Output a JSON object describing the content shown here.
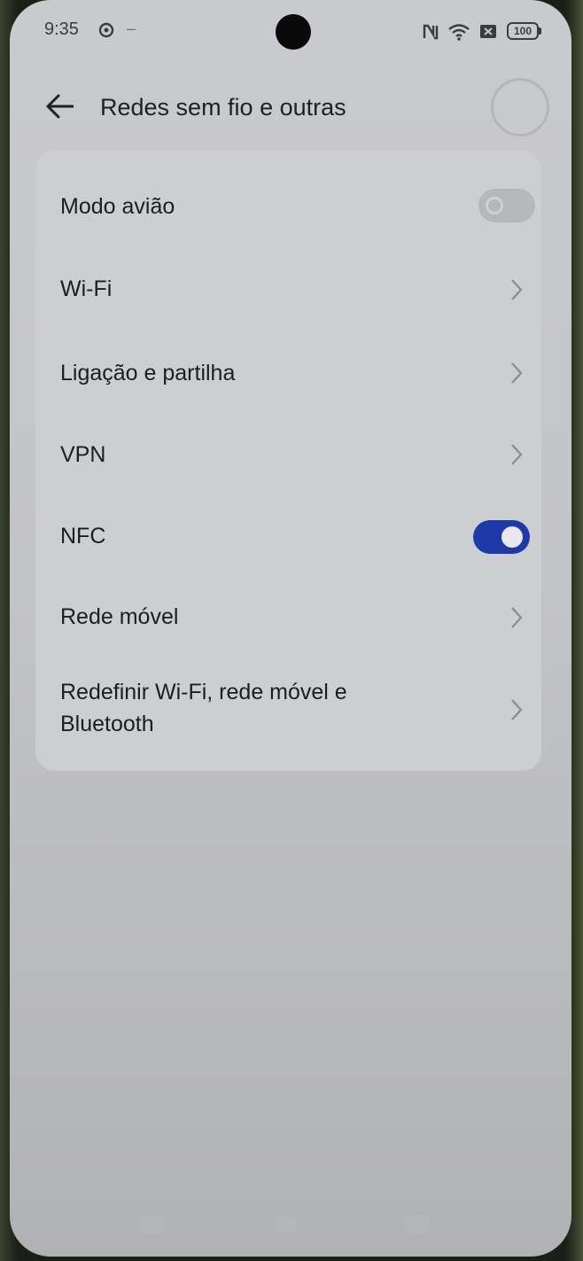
{
  "status_bar": {
    "time": "9:35",
    "battery_level": "100",
    "icons": [
      "gear-icon",
      "nfc-icon",
      "wifi-icon",
      "sim-icon",
      "battery-icon"
    ]
  },
  "header": {
    "title": "Redes sem fio e outras",
    "back_icon": "arrow-left-icon"
  },
  "settings": {
    "items": [
      {
        "label": "Modo avião",
        "control": "toggle",
        "on": false
      },
      {
        "label": "Wi-Fi",
        "control": "chevron"
      },
      {
        "label": "Ligação e partilha",
        "control": "chevron"
      },
      {
        "label": "VPN",
        "control": "chevron"
      },
      {
        "label": "NFC",
        "control": "toggle",
        "on": true
      },
      {
        "label": "Rede móvel",
        "control": "chevron"
      },
      {
        "label": "Redefinir Wi-Fi, rede móvel e Bluetooth",
        "control": "chevron"
      }
    ]
  },
  "colors": {
    "accent": "#1d3aa6",
    "background": "#c3c4c8",
    "card": "#cdced2",
    "text": "#1c1d20"
  }
}
